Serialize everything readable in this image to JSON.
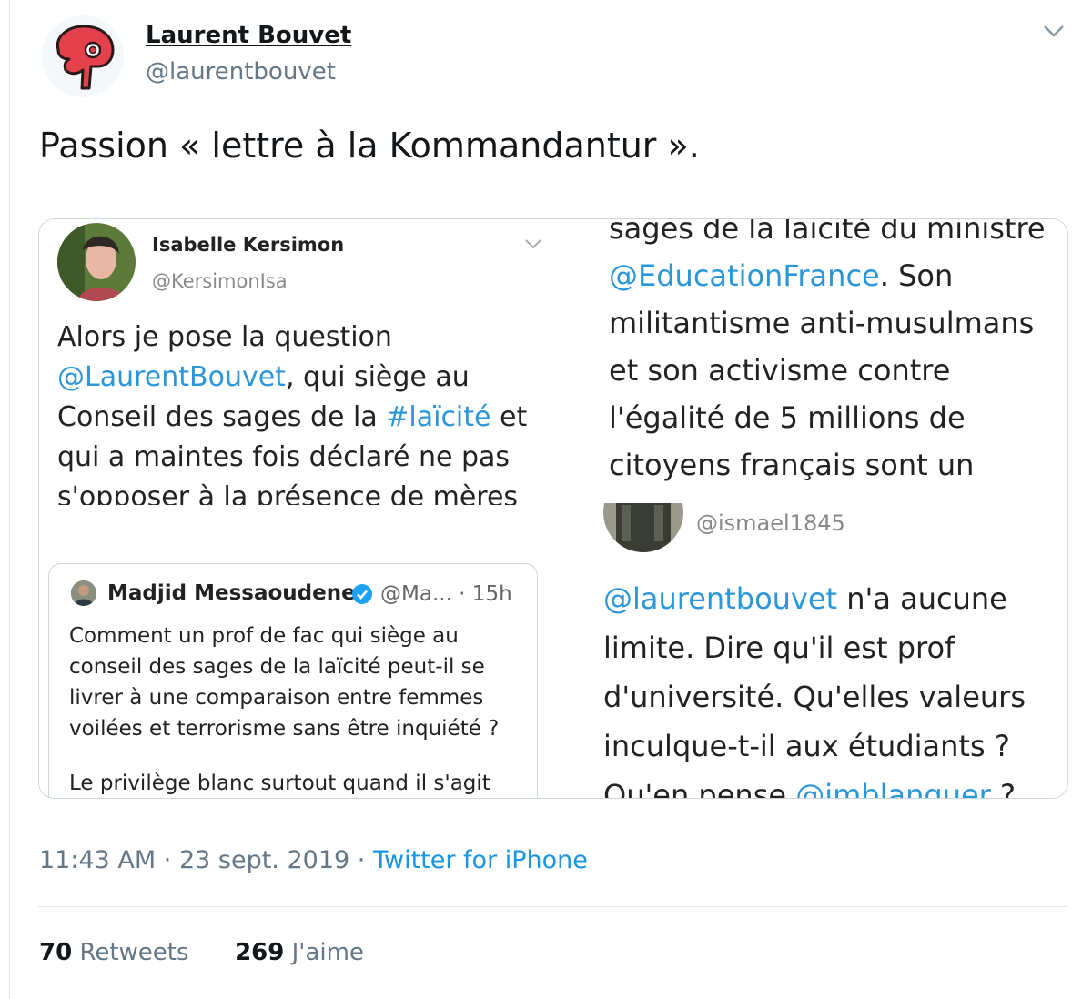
{
  "tweet": {
    "author_name": "Laurent Bouvet",
    "author_handle": "@laurentbouvet",
    "text": "Passion « lettre à la Kommandantur ».",
    "time": "11:43 AM",
    "date": "23 sept. 2019",
    "separator": "·",
    "source": "Twitter for iPhone",
    "retweets_count": "70",
    "retweets_label": "Retweets",
    "likes_count": "269",
    "likes_label": "J'aime"
  },
  "media": {
    "tweet1": {
      "author_name": "Isabelle Kersimon",
      "author_handle": "@KersimonIsa",
      "body_pre": "Alors je pose la question ",
      "mention": "@LaurentBouvet",
      "body_mid": ", qui siège au Conseil des sages de la ",
      "hashtag": "#laïcité",
      "body_post": " et qui a maintes fois déclaré ne pas s'opposer à la présence de mères"
    },
    "quote": {
      "author_name": "Madjid Messaoudene",
      "handle_time": "@Ma... · 15h",
      "body": "Comment un prof de fac qui siège au conseil des sages de la laïcité  peut-il se livrer à une comparaison entre femmes voilées et terrorisme sans être inquiété ?",
      "body2": "Le privilège blanc surtout quand il s'agit"
    },
    "tweet2": {
      "body_pre": "sages de la laïcité du ministre ",
      "mention": "@EducationFrance",
      "body_post": ". Son militantisme anti-musulmans et son activisme contre l'égalité de 5 millions de citoyens français sont un danger pour la République"
    },
    "tweet3": {
      "author_handle": "@ismael1845",
      "mention": "@laurentbouvet",
      "body": " n'a aucune limite. Dire qu'il est prof d'université. Qu'elles valeurs inculque-t-il aux étudiants ? Qu'en pense ",
      "mention2": "@jmblanquer",
      "body_end": " ?"
    }
  },
  "colors": {
    "link": "#1b95e0",
    "secondary": "#657786",
    "border": "#e1e8ed",
    "logo_red": "#e5414c"
  },
  "icons": {
    "avatar": "red-phrygian-cap-logo",
    "menu": "chevron-down-icon",
    "verified": "verified-badge-icon"
  }
}
